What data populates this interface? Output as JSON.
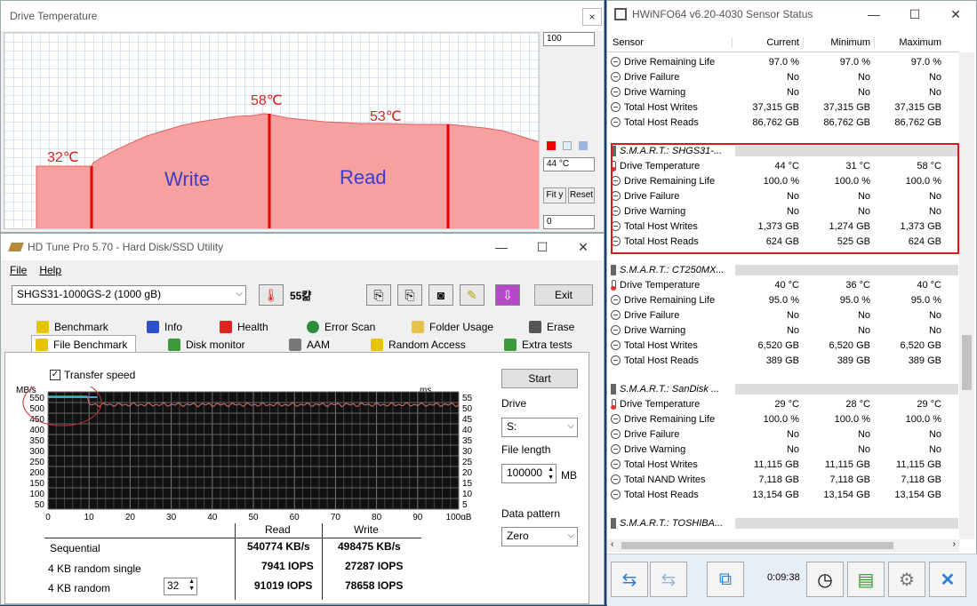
{
  "drive_temp": {
    "title": "Drive Temperature",
    "close": "×",
    "max_box": "100",
    "cur_box": "44 °C",
    "min_box": "0",
    "fit_label": "Fit y",
    "reset_label": "Reset",
    "label_32": "32℃",
    "label_58": "58℃",
    "label_53": "53℃",
    "write_label": "Write",
    "read_label": "Read"
  },
  "hdtune": {
    "title": "HD Tune Pro 5.70 - Hard Disk/SSD Utility",
    "menu_file": "File",
    "menu_help": "Help",
    "drive_select": "SHGS31-1000GS-2 (1000 gB)",
    "temp_readout": "55캶",
    "exit_label": "Exit",
    "tabs_top": [
      "Benchmark",
      "Info",
      "Health",
      "Error Scan",
      "Folder Usage",
      "Erase"
    ],
    "tabs_bottom": [
      "File Benchmark",
      "Disk monitor",
      "AAM",
      "Random Access",
      "Extra tests"
    ],
    "transfer_speed": "Transfer speed",
    "start_label": "Start",
    "drive_label": "Drive",
    "drive_value": "S:",
    "file_length_label": "File length",
    "file_length_value": "100000",
    "file_length_unit": "MB",
    "pattern_label": "Data pattern",
    "pattern_value": "Zero",
    "col_read": "Read",
    "col_write": "Write",
    "rows": [
      {
        "label": "Sequential",
        "read": "540774 KB/s",
        "write": "498475 KB/s"
      },
      {
        "label": "4 KB random single",
        "read": "7941 IOPS",
        "write": "27287 IOPS"
      },
      {
        "label": "4 KB random",
        "read": "91019 IOPS",
        "write": "78658 IOPS"
      }
    ],
    "queue_depth": "32"
  },
  "chart_data": {
    "type": "line",
    "y_left_label": "MB/s",
    "y_right_label": "ms",
    "x_ticks": [
      "0",
      "10",
      "20",
      "30",
      "40",
      "50",
      "60",
      "70",
      "80",
      "90",
      "100gB"
    ],
    "y_left_ticks": [
      "550",
      "500",
      "450",
      "400",
      "350",
      "300",
      "250",
      "200",
      "150",
      "100",
      "50"
    ],
    "y_right_ticks": [
      "55",
      "50",
      "45",
      "40",
      "35",
      "30",
      "25",
      "20",
      "15",
      "10",
      "5"
    ],
    "ylim": [
      0,
      550
    ],
    "xlim": [
      0,
      100
    ],
    "series": [
      {
        "name": "Transfer speed",
        "values_approx": 490
      }
    ]
  },
  "hwinfo": {
    "title": "HWiNFO64 v6.20-4030 Sensor Status",
    "columns": [
      "Sensor",
      "Current",
      "Minimum",
      "Maximum"
    ],
    "rows_top": [
      {
        "icon": "circle",
        "name": "Drive Remaining Life",
        "cur": "97.0 %",
        "min": "97.0 %",
        "max": "97.0 %"
      },
      {
        "icon": "circle",
        "name": "Drive Failure",
        "cur": "No",
        "min": "No",
        "max": "No"
      },
      {
        "icon": "circle",
        "name": "Drive Warning",
        "cur": "No",
        "min": "No",
        "max": "No"
      },
      {
        "icon": "circle",
        "name": "Total Host Writes",
        "cur": "37,315 GB",
        "min": "37,315 GB",
        "max": "37,315 GB"
      },
      {
        "icon": "circle",
        "name": "Total Host Reads",
        "cur": "86,762 GB",
        "min": "86,762 GB",
        "max": "86,762 GB"
      }
    ],
    "groups": [
      {
        "title": "S.M.A.R.T.: SHGS31-...",
        "rows": [
          {
            "icon": "temp",
            "name": "Drive Temperature",
            "cur": "44 °C",
            "min": "31 °C",
            "max": "58 °C"
          },
          {
            "icon": "circle",
            "name": "Drive Remaining Life",
            "cur": "100.0 %",
            "min": "100.0 %",
            "max": "100.0 %"
          },
          {
            "icon": "circle",
            "name": "Drive Failure",
            "cur": "No",
            "min": "No",
            "max": "No"
          },
          {
            "icon": "circle",
            "name": "Drive Warning",
            "cur": "No",
            "min": "No",
            "max": "No"
          },
          {
            "icon": "circle",
            "name": "Total Host Writes",
            "cur": "1,373 GB",
            "min": "1,274 GB",
            "max": "1,373 GB"
          },
          {
            "icon": "circle",
            "name": "Total Host Reads",
            "cur": "624 GB",
            "min": "525 GB",
            "max": "624 GB"
          }
        ]
      },
      {
        "title": "S.M.A.R.T.: CT250MX...",
        "rows": [
          {
            "icon": "temp",
            "name": "Drive Temperature",
            "cur": "40 °C",
            "min": "36 °C",
            "max": "40 °C"
          },
          {
            "icon": "circle",
            "name": "Drive Remaining Life",
            "cur": "95.0 %",
            "min": "95.0 %",
            "max": "95.0 %"
          },
          {
            "icon": "circle",
            "name": "Drive Failure",
            "cur": "No",
            "min": "No",
            "max": "No"
          },
          {
            "icon": "circle",
            "name": "Drive Warning",
            "cur": "No",
            "min": "No",
            "max": "No"
          },
          {
            "icon": "circle",
            "name": "Total Host Writes",
            "cur": "6,520 GB",
            "min": "6,520 GB",
            "max": "6,520 GB"
          },
          {
            "icon": "circle",
            "name": "Total Host Reads",
            "cur": "389 GB",
            "min": "389 GB",
            "max": "389 GB"
          }
        ]
      },
      {
        "title": "S.M.A.R.T.: SanDisk ...",
        "rows": [
          {
            "icon": "temp",
            "name": "Drive Temperature",
            "cur": "29 °C",
            "min": "28 °C",
            "max": "29 °C"
          },
          {
            "icon": "circle",
            "name": "Drive Remaining Life",
            "cur": "100.0 %",
            "min": "100.0 %",
            "max": "100.0 %"
          },
          {
            "icon": "circle",
            "name": "Drive Failure",
            "cur": "No",
            "min": "No",
            "max": "No"
          },
          {
            "icon": "circle",
            "name": "Drive Warning",
            "cur": "No",
            "min": "No",
            "max": "No"
          },
          {
            "icon": "circle",
            "name": "Total Host Writes",
            "cur": "11,115 GB",
            "min": "11,115 GB",
            "max": "11,115 GB"
          },
          {
            "icon": "circle",
            "name": "Total NAND Writes",
            "cur": "7,118 GB",
            "min": "7,118 GB",
            "max": "7,118 GB"
          },
          {
            "icon": "circle",
            "name": "Total Host Reads",
            "cur": "13,154 GB",
            "min": "13,154 GB",
            "max": "13,154 GB"
          }
        ]
      },
      {
        "title": "S.M.A.R.T.: TOSHIBA...",
        "rows": []
      }
    ],
    "timer": "0:09:38"
  }
}
